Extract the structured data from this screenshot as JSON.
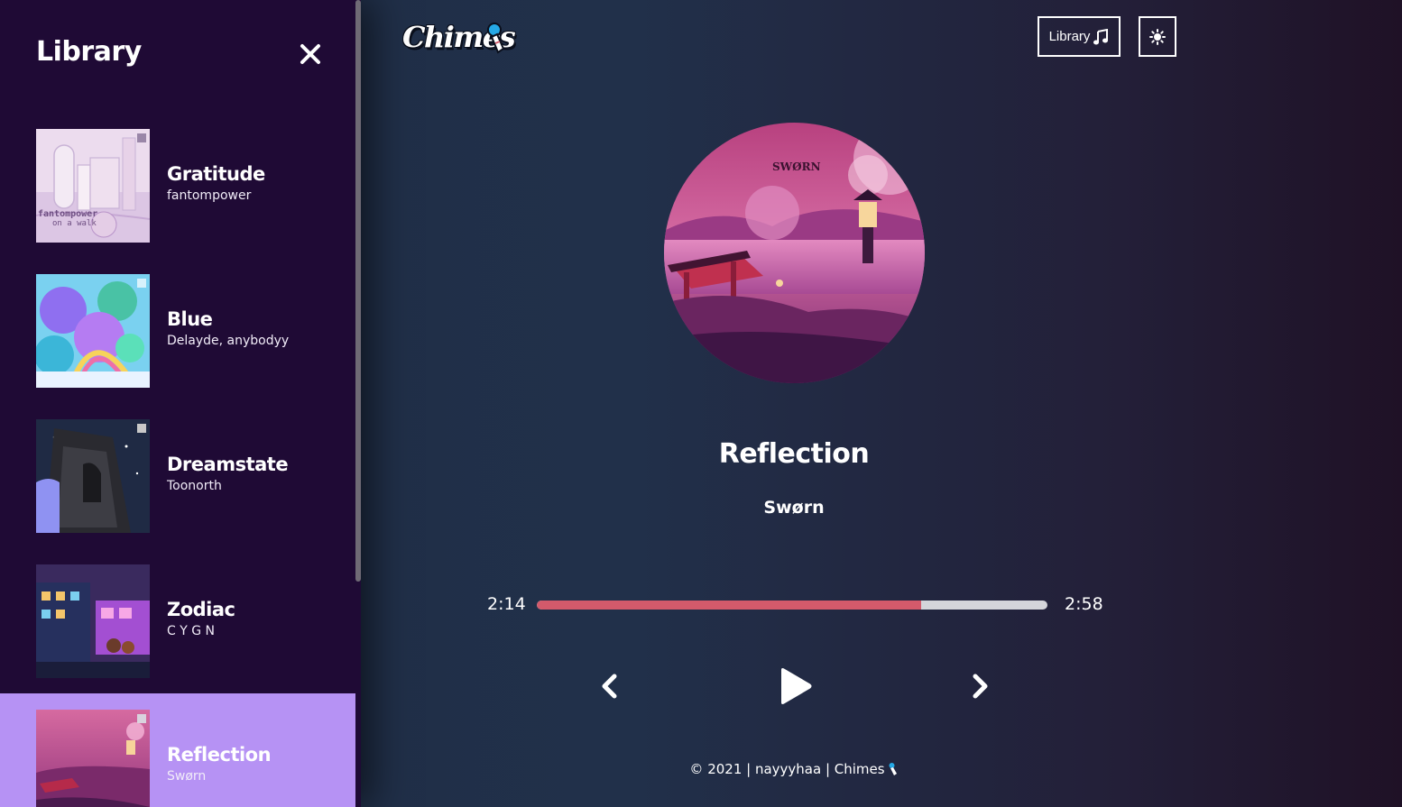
{
  "sidebar": {
    "title": "Library",
    "tracks": [
      {
        "name": "Gratitude",
        "artist": "fantompower",
        "cover_text": "fantompower",
        "cover_subtext": "on a walk",
        "active": false
      },
      {
        "name": "Blue",
        "artist": "Delayde, anybodyy",
        "active": false
      },
      {
        "name": "Dreamstate",
        "artist": "Toonorth",
        "active": false
      },
      {
        "name": "Zodiac",
        "artist": "C Y G N",
        "active": false
      },
      {
        "name": "Reflection",
        "artist": "Swørn",
        "active": true
      }
    ]
  },
  "nav": {
    "logo": "Chimes",
    "library_label": "Library"
  },
  "player": {
    "album_text": "SWØRN",
    "title": "Reflection",
    "artist": "Swørn",
    "current_time": "2:14",
    "total_time": "2:58",
    "progress": 0.752
  },
  "footer": {
    "text": "© 2021 | nayyyhaa | Chimes"
  },
  "colors": {
    "sidebar_bg": "#1f0a35",
    "active_track": "#b692f4",
    "progress_fill": "#d35a6b",
    "progress_track": "#d4d5da"
  },
  "icons": {
    "close": "close-icon",
    "library": "music-note-icon",
    "theme": "sun-icon",
    "prev": "chevron-left-icon",
    "play": "play-icon",
    "next": "chevron-right-icon",
    "logo": "wind-chime-icon"
  }
}
